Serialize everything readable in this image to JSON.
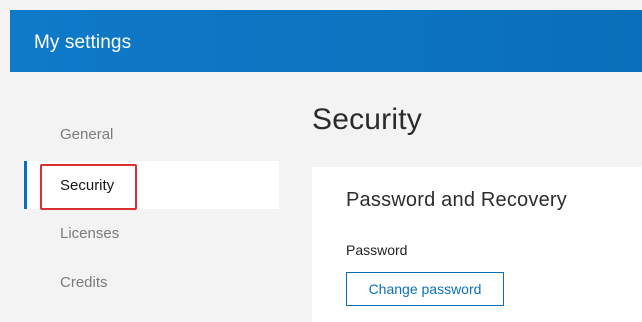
{
  "header": {
    "title": "My settings"
  },
  "sidebar": {
    "items": [
      {
        "label": "General",
        "active": false
      },
      {
        "label": "Security",
        "active": true
      },
      {
        "label": "Licenses",
        "active": false
      },
      {
        "label": "Credits",
        "active": false
      }
    ]
  },
  "main": {
    "title": "Security",
    "card": {
      "title": "Password and Recovery",
      "password_label": "Password",
      "change_password_label": "Change password"
    }
  },
  "colors": {
    "brand_blue": "#0a6fba",
    "highlight_red": "#d9312f"
  }
}
